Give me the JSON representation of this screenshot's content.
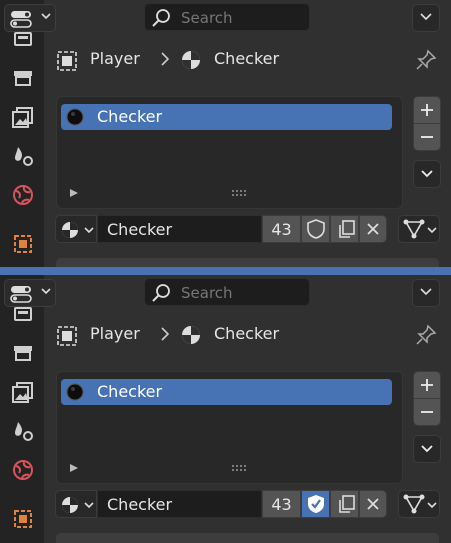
{
  "panels": [
    {
      "search_placeholder": "Search",
      "breadcrumb": {
        "object": "Player",
        "material": "Checker"
      },
      "material_slots": [
        {
          "name": "Checker",
          "selected": true
        }
      ],
      "material_name": "Checker",
      "user_count": "43",
      "fake_user_enabled": false
    },
    {
      "search_placeholder": "Search",
      "breadcrumb": {
        "object": "Player",
        "material": "Checker"
      },
      "material_slots": [
        {
          "name": "Checker",
          "selected": true
        }
      ],
      "material_name": "Checker",
      "user_count": "43",
      "fake_user_enabled": true
    }
  ],
  "sidebar_tabs": [
    "output-properties-icon",
    "render-properties-icon",
    "view-layer-icon",
    "scene-icon",
    "world-icon",
    "object-properties-icon"
  ],
  "colors": {
    "accent": "#4772b3",
    "separator": "#4a72b0",
    "background": "#303030",
    "sidebar": "#232323"
  }
}
